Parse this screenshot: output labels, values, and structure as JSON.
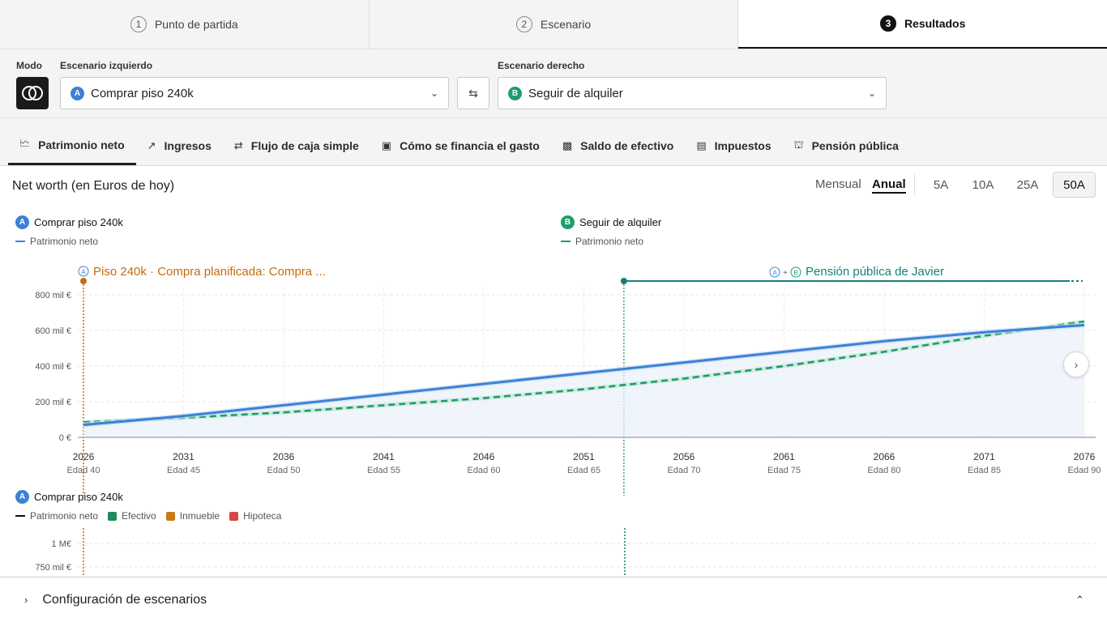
{
  "steps": [
    {
      "num": "1",
      "label": "Punto de partida"
    },
    {
      "num": "2",
      "label": "Escenario"
    },
    {
      "num": "3",
      "label": "Resultados"
    }
  ],
  "controls": {
    "mode_label": "Modo",
    "left_label": "Escenario izquierdo",
    "right_label": "Escenario derecho",
    "left_badge": "A",
    "left_value": "Comprar piso 240k",
    "right_badge": "B",
    "right_value": "Seguir de alquiler"
  },
  "tabs": [
    {
      "label": "Patrimonio neto",
      "icon": "chart-icon"
    },
    {
      "label": "Ingresos",
      "icon": "trend-icon"
    },
    {
      "label": "Flujo de caja simple",
      "icon": "swap-icon"
    },
    {
      "label": "Cómo se financia el gasto",
      "icon": "wallet-icon"
    },
    {
      "label": "Saldo de efectivo",
      "icon": "cash-icon"
    },
    {
      "label": "Impuestos",
      "icon": "receipt-icon"
    },
    {
      "label": "Pensión pública",
      "icon": "bank-icon"
    }
  ],
  "chart_header": {
    "title": "Net worth (en Euros de hoy)",
    "mensual": "Mensual",
    "anual": "Anual",
    "ranges": [
      "5A",
      "10A",
      "25A",
      "50A"
    ]
  },
  "legend": {
    "a_badge": "A",
    "a_name": "Comprar piso 240k",
    "a_series": "Patrimonio neto",
    "b_badge": "B",
    "b_name": "Seguir de alquiler",
    "b_series": "Patrimonio neto"
  },
  "events": {
    "left_badge": "A",
    "left_text": "Piso 240k · Compra planificada: Compra ...",
    "right_badge_a": "A",
    "plus": "+",
    "right_badge_b": "B",
    "right_text": "Pensión pública de Javier"
  },
  "chart_data": {
    "type": "line",
    "x": [
      2026,
      2031,
      2036,
      2041,
      2046,
      2051,
      2056,
      2061,
      2066,
      2071,
      2076
    ],
    "x_ticks": [
      "2026",
      "2031",
      "2036",
      "2041",
      "2046",
      "2051",
      "2056",
      "2061",
      "2066",
      "2071",
      "2076"
    ],
    "x_sub": [
      "Edad 40",
      "Edad 45",
      "Edad 50",
      "Edad 55",
      "Edad 60",
      "Edad 65",
      "Edad 70",
      "Edad 75",
      "Edad 80",
      "Edad 85",
      "Edad 90"
    ],
    "y_ticks": [
      "0 €",
      "200 mil €",
      "400 mil €",
      "600 mil €",
      "800 mil €"
    ],
    "ylim": [
      0,
      800000
    ],
    "series": [
      {
        "name": "Patrimonio neto",
        "scenario": "Comprar piso 240k",
        "color": "#3b82d6",
        "values": [
          70000,
          120000,
          180000,
          240000,
          300000,
          360000,
          420000,
          480000,
          540000,
          590000,
          630000
        ]
      },
      {
        "name": "Patrimonio neto",
        "scenario": "Seguir de alquiler",
        "color": "#1f9d6b",
        "values": [
          85000,
          110000,
          140000,
          180000,
          220000,
          270000,
          330000,
          400000,
          480000,
          570000,
          650000
        ]
      }
    ],
    "events": [
      {
        "year": 2026,
        "color": "#c56d0a"
      },
      {
        "year": 2053,
        "color": "#177f7a"
      }
    ]
  },
  "lower": {
    "badge": "A",
    "name": "Comprar piso 240k",
    "legend": [
      {
        "label": "Patrimonio neto",
        "color": "#111111",
        "kind": "line"
      },
      {
        "label": "Efectivo",
        "color": "#1f8a5a",
        "kind": "square"
      },
      {
        "label": "Inmueble",
        "color": "#c9781a",
        "kind": "square"
      },
      {
        "label": "Hipoteca",
        "color": "#d64545",
        "kind": "square"
      }
    ],
    "y_ticks": [
      "1 M€",
      "750 mil €"
    ]
  },
  "footer": {
    "title": "Configuración de escenarios"
  }
}
